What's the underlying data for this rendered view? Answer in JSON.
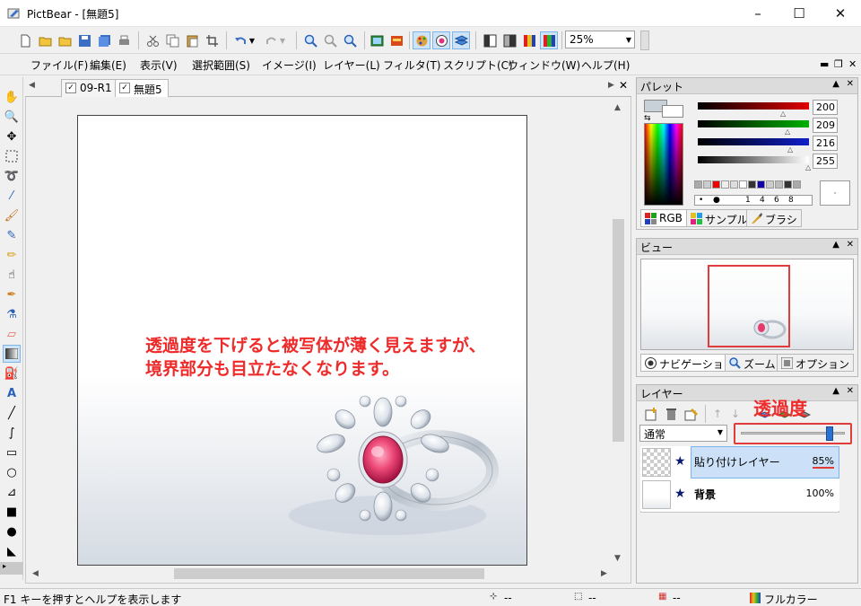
{
  "window": {
    "title": "PictBear - [無題5]",
    "minimize": "–",
    "maximize": "☐",
    "close": "✕"
  },
  "toolbar": {
    "zoom_value": "25%"
  },
  "menu": {
    "items": [
      "ファイル(F)",
      "編集(E)",
      "表示(V)",
      "選択範囲(S)",
      "イメージ(I)",
      "レイヤー(L)",
      "フィルタ(T)",
      "スクリプト(C)",
      "ウィンドウ(W)",
      "ヘルプ(H)"
    ],
    "mdi_minimize": "▬",
    "mdi_restore": "❐",
    "mdi_close": "✕"
  },
  "documents": {
    "tabs": [
      "09-R1",
      "無題5"
    ],
    "active_tab": 1,
    "close": "✕",
    "annotation_line1": "透過度を下げると被写体が薄く見えますが、",
    "annotation_line2": "境界部分も目立たなくなります。"
  },
  "palette": {
    "title": "パレット",
    "pin": "▲",
    "close": "✕",
    "r": "200",
    "g": "209",
    "b": "216",
    "a": "255",
    "swatch_labels": [
      "1",
      "4",
      "6",
      "8"
    ],
    "tabs": [
      "RGB",
      "サンプル",
      "ブラシ"
    ],
    "colors": {
      "r": "#e00000",
      "g": "#00b000",
      "b": "#1020c8"
    }
  },
  "view_panel": {
    "title": "ビュー",
    "pin": "▲",
    "close": "✕",
    "tabs": [
      "ナビゲーション",
      "ズーム",
      "オプション"
    ]
  },
  "layers": {
    "title": "レイヤー",
    "pin": "▲",
    "close": "✕",
    "blend_mode": "通常",
    "opacity_annotation": "透過度",
    "opacity_fraction": 0.85,
    "rows": [
      {
        "name": "貼り付けレイヤー",
        "opacity": "85%",
        "selected": true
      },
      {
        "name": "背景",
        "opacity": "100%",
        "selected": false
      }
    ]
  },
  "status": {
    "help": "F1 キーを押すとヘルプを表示します",
    "pos": "--",
    "size": "--",
    "color": "--",
    "mode": "フルカラー"
  },
  "colors": {
    "accent_red": "#ee2b2b",
    "selection": "#cce0f8",
    "highlight": "#7eb4ea"
  }
}
